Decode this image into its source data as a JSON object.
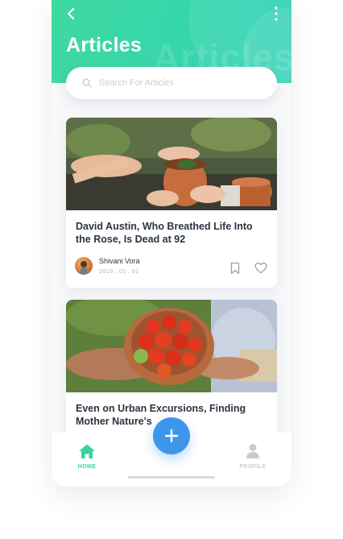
{
  "header": {
    "title": "Articles",
    "watermark": "Articles",
    "back_icon": "chevron-left-icon",
    "more_icon": "more-vertical-icon"
  },
  "search": {
    "placeholder": "Search For Articles",
    "value": ""
  },
  "articles": [
    {
      "title": "David Austin, Who Breathed Life Into the Rose, Is Dead at 92",
      "author": "Shivani Vora",
      "date": "2019 . 01 . 01",
      "image": "hands-potting-plant-photo"
    },
    {
      "title": "Even on Urban Excursions, Finding Mother Nature's",
      "image": "bowl-of-tomatoes-photo"
    }
  ],
  "nav": {
    "home_label": "HOME",
    "profile_label": "PROFILE",
    "add_icon": "plus-icon"
  },
  "colors": {
    "accent": "#3ad39e",
    "fab": "#3d96ea",
    "inactive": "#c8ccd2"
  }
}
